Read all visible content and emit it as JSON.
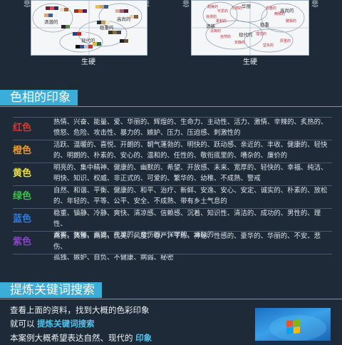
{
  "top": {
    "corner_chars": [
      "悲",
      "悲",
      "悲",
      "悲"
    ],
    "left_chart": {
      "axis_label": "生硬",
      "cluster_labels": [
        "清澈的",
        "高尚的",
        "稳重的",
        "现代的"
      ]
    },
    "right_chart": {
      "axis_label": "生硬",
      "cluster_labels": [
        "华丽",
        "清新",
        "高尚的",
        "稳重",
        "现代的"
      ]
    }
  },
  "hue_section": {
    "title": "色相的印象",
    "rows": [
      {
        "name": "红色",
        "color": "#e8322e",
        "lines": [
          "热情、兴奋、能量、爱、华丽的、辉煌的、生命力、主动性、活力、激情、辛辣的、炙热的、",
          "愤怒、危险、攻击性、暴力的、嫉妒、压力、压迫感、刺激性的"
        ]
      },
      {
        "name": "橙色",
        "color": "#f39a1e",
        "lines": [
          "活跃、温暖的、喜悦、开朗的、朝气蓬勃的、明快的、跃动感、亲近的、丰收、健康的、轻快",
          "的、明朗的、朴素的、安心的、温和的、任性的、敬衔底里的、嘈杂的、廉价的"
        ]
      },
      {
        "name": "黄色",
        "color": "#f2e21c",
        "lines": [
          "明亮的、集中精神、健康的、幽默的、希望、开放感、未来、宽厚的、轻快的、幸福、纯洁、",
          "明快、知识、权威、非正式的、可爱的、繁华的、幼稚、不成熟、警戒"
        ]
      },
      {
        "name": "绿色",
        "color": "#3fbe4a",
        "lines": [
          "自然、和谐、平衡、健康的、和平、治疗、新鲜、安逸、安心、安定、诚实的、朴素的、放松",
          "的、年轻的、平等、公平、安全、不成熟、带有乡土气息的"
        ]
      },
      {
        "name": "蓝色",
        "color": "#2a7fe0",
        "lines": [
          "稳重、镇静、冷静、爽快、清凉感、信赖感、沉着、知识性、清洁的、成功的、男性的、理性、",
          "诚实、忧郁、孤独、荒凉的、悲伤的、保守的、消极的"
        ]
      },
      {
        "name": "紫色",
        "color": "#8a44c8",
        "lines": [
          "高贵、典雅、高尚、优美、风度、尊严、干练、神秘、性感的、豪华的、华丽的、不安、悲伤、",
          "孤独、嫉妒、自负、不健康、病弱、秘密"
        ]
      }
    ]
  },
  "keyword_section": {
    "title": "提炼关键词搜索",
    "line1": "查看上面的资料，找到大概的色彩印象",
    "line2_prefix": "就可以",
    "line2_highlight": "提炼关键词搜索",
    "line3_prefix": "本案例大概希望表达自然、现代的",
    "line3_highlight": "印象"
  },
  "colors": {
    "background": "#1e2a38",
    "accent": "#3aaed8",
    "highlight": "#4ec3ee"
  }
}
